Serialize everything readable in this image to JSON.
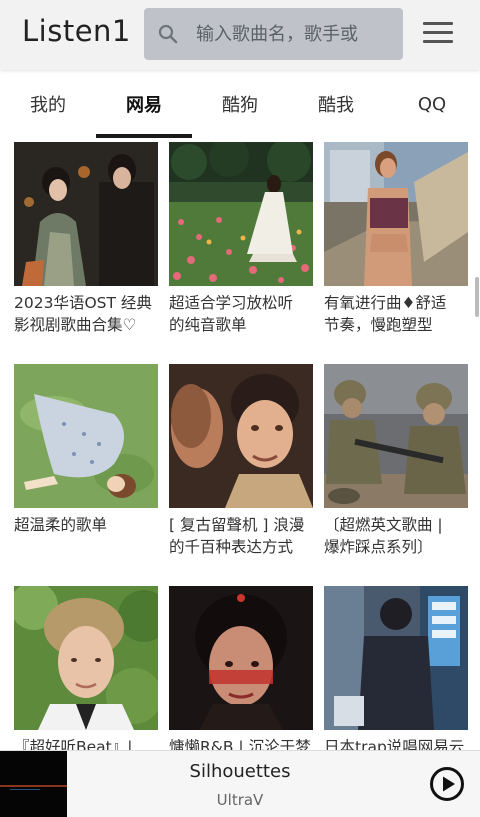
{
  "header": {
    "app_title": "Listen1",
    "search_placeholder": "输入歌曲名，歌手或"
  },
  "tabs": [
    {
      "label": "我的",
      "active": false
    },
    {
      "label": "网易",
      "active": true
    },
    {
      "label": "酷狗",
      "active": false
    },
    {
      "label": "酷我",
      "active": false
    },
    {
      "label": "QQ",
      "active": false
    }
  ],
  "playlists": [
    {
      "title_line1": "2023华语OST 经典",
      "title_line2": "影视剧歌曲合集♡"
    },
    {
      "title_line1": "超适合学习放松听",
      "title_line2": "的纯音歌单"
    },
    {
      "title_line1": "有氧进行曲♦舒适",
      "title_line2": "节奏，慢跑塑型"
    },
    {
      "title_line1": "超温柔的歌单",
      "title_line2": ""
    },
    {
      "title_line1": "[ 复古留聲机 ] 浪漫",
      "title_line2": "的千百种表达方式"
    },
    {
      "title_line1": "〔超燃英文歌曲 |",
      "title_line2": "爆炸踩点系列〕"
    },
    {
      "title_line1": "『超好听Beat』|",
      "title_line2": ""
    },
    {
      "title_line1": "慵懒R&B | 沉沦于梦",
      "title_line2": ""
    },
    {
      "title_line1": "日本trap说唱网易云",
      "title_line2": ""
    }
  ],
  "player": {
    "song_title": "Silhouettes",
    "artist": "UltraV"
  },
  "colors": {
    "topbar_bg": "#f2f2f2",
    "search_bg": "#bfc3c9",
    "active_tab_indicator": "#1a1a1a",
    "player_bg": "#f6f6f6"
  }
}
